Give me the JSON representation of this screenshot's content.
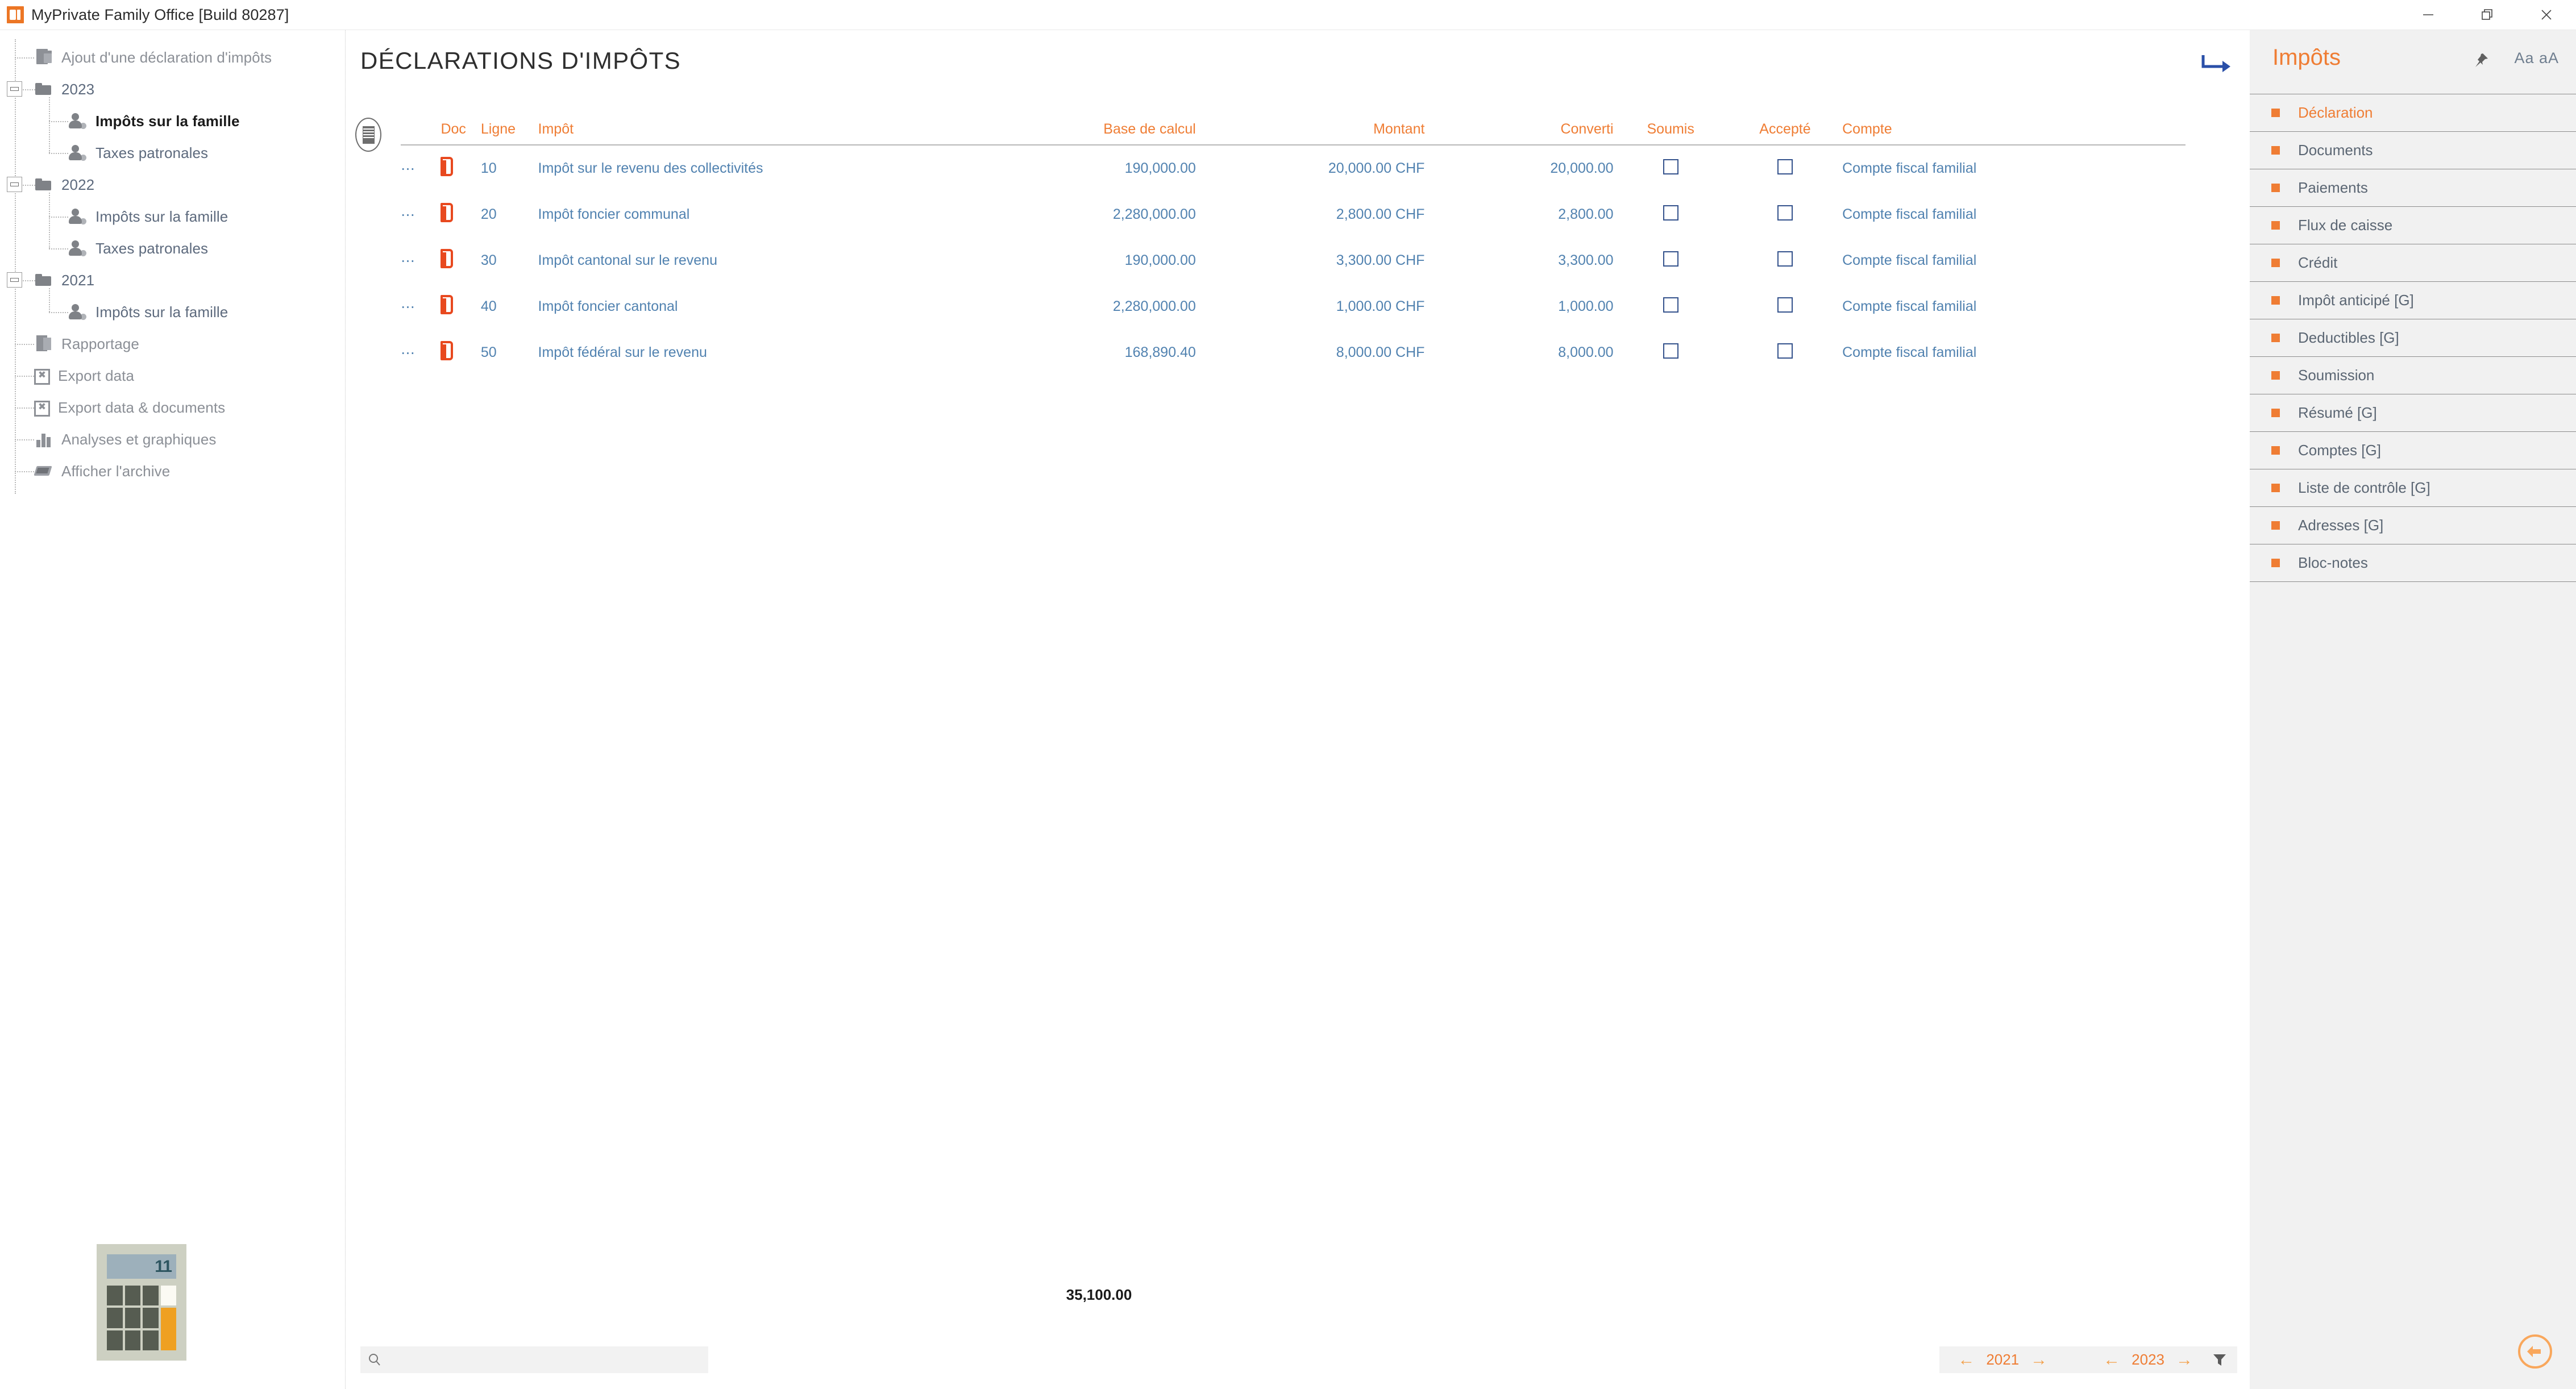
{
  "window": {
    "title": "MyPrivate Family Office [Build 80287]",
    "controls": {
      "minimize": "minimize-icon",
      "maximize": "maximize-icon",
      "close": "close-icon"
    }
  },
  "sidebar": {
    "items": [
      {
        "label": "Ajout d'une déclaration d'impôts",
        "icon": "document-add-icon",
        "level": 0,
        "type": "action"
      },
      {
        "label": "2023",
        "icon": "folder-icon",
        "level": 0,
        "type": "folder",
        "expanded": true
      },
      {
        "label": "Impôts sur la famille",
        "icon": "family-icon",
        "level": 1,
        "type": "node",
        "active": true
      },
      {
        "label": "Taxes patronales",
        "icon": "family-icon",
        "level": 1,
        "type": "node"
      },
      {
        "label": "2022",
        "icon": "folder-icon",
        "level": 0,
        "type": "folder",
        "expanded": true
      },
      {
        "label": "Impôts sur la famille",
        "icon": "family-icon",
        "level": 1,
        "type": "node"
      },
      {
        "label": "Taxes patronales",
        "icon": "family-icon",
        "level": 1,
        "type": "node"
      },
      {
        "label": "2021",
        "icon": "folder-icon",
        "level": 0,
        "type": "folder",
        "expanded": true
      },
      {
        "label": "Impôts sur la famille",
        "icon": "family-icon",
        "level": 1,
        "type": "node"
      },
      {
        "label": "Rapportage",
        "icon": "report-icon",
        "level": 0,
        "type": "action"
      },
      {
        "label": "Export data",
        "icon": "export-icon",
        "level": 0,
        "type": "action"
      },
      {
        "label": "Export data & documents",
        "icon": "export-icon",
        "level": 0,
        "type": "action"
      },
      {
        "label": "Analyses et graphiques",
        "icon": "chart-icon",
        "level": 0,
        "type": "action"
      },
      {
        "label": "Afficher l'archive",
        "icon": "archive-icon",
        "level": 0,
        "type": "action"
      }
    ],
    "calculator": {
      "display": "11"
    }
  },
  "main": {
    "page_title": "DÉCLARATIONS D'IMPÔTS",
    "redirect_icon": "forward-arrow-icon",
    "grid_button": "column-chooser-icon",
    "columns": [
      "Doc",
      "Ligne",
      "Impôt",
      "Base de calcul",
      "Montant",
      "Converti",
      "Soumis",
      "Accepté",
      "Compte"
    ],
    "rows": [
      {
        "doc": "document-icon",
        "ligne": "10",
        "impot": "Impôt sur le revenu des collectivités",
        "base": "190,000.00",
        "montant": "20,000.00 CHF",
        "converti": "20,000.00",
        "soumis": false,
        "accepte": false,
        "compte": "Compte fiscal familial"
      },
      {
        "doc": "document-icon",
        "ligne": "20",
        "impot": "Impôt foncier communal",
        "base": "2,280,000.00",
        "montant": "2,800.00 CHF",
        "converti": "2,800.00",
        "soumis": false,
        "accepte": false,
        "compte": "Compte fiscal familial"
      },
      {
        "doc": "document-icon",
        "ligne": "30",
        "impot": "Impôt cantonal sur le revenu",
        "base": "190,000.00",
        "montant": "3,300.00 CHF",
        "converti": "3,300.00",
        "soumis": false,
        "accepte": false,
        "compte": "Compte fiscal familial"
      },
      {
        "doc": "document-icon",
        "ligne": "40",
        "impot": "Impôt foncier cantonal",
        "base": "2,280,000.00",
        "montant": "1,000.00 CHF",
        "converti": "1,000.00",
        "soumis": false,
        "accepte": false,
        "compte": "Compte fiscal familial"
      },
      {
        "doc": "document-icon",
        "ligne": "50",
        "impot": "Impôt fédéral sur le revenu",
        "base": "168,890.40",
        "montant": "8,000.00 CHF",
        "converti": "8,000.00",
        "soumis": false,
        "accepte": false,
        "compte": "Compte fiscal familial"
      }
    ],
    "total": "35,100.00",
    "search": {
      "value": "",
      "placeholder": ""
    },
    "pager": {
      "left_year": "2021",
      "right_year": "2023",
      "prev": "←",
      "next": "→",
      "filter_icon": "funnel-icon"
    }
  },
  "right_panel": {
    "title": "Impôts",
    "pin_icon": "pin-icon",
    "font_size_label": "Aa aA",
    "items": [
      {
        "label": "Déclaration",
        "active": true
      },
      {
        "label": "Documents",
        "active": false
      },
      {
        "label": "Paiements",
        "active": false
      },
      {
        "label": "Flux de caisse",
        "active": false
      },
      {
        "label": "Crédit",
        "active": false
      },
      {
        "label": "Impôt anticipé [G]",
        "active": false
      },
      {
        "label": "Deductibles [G]",
        "active": false
      },
      {
        "label": "Soumission",
        "active": false
      },
      {
        "label": "Résumé [G]",
        "active": false
      },
      {
        "label": "Comptes [G]",
        "active": false
      },
      {
        "label": "Liste de contrôle [G]",
        "active": false
      },
      {
        "label": "Adresses [G]",
        "active": false
      },
      {
        "label": "Bloc-notes",
        "active": false
      }
    ],
    "back_button": "back-arrow-icon"
  },
  "colors": {
    "accent_orange": "#ef7d34",
    "link_blue": "#5182b0",
    "doc_red": "#e8491f",
    "panel_bg": "#f1f1f1"
  }
}
